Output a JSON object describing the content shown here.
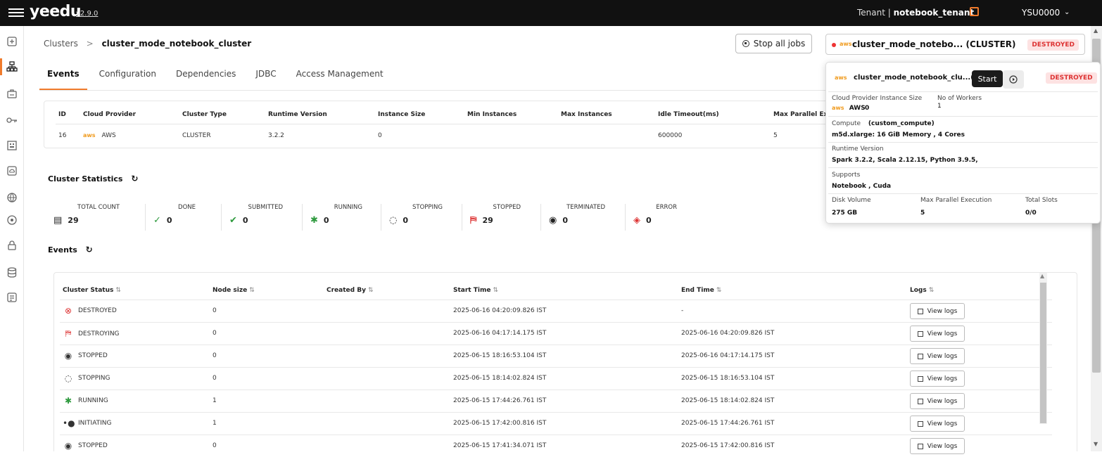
{
  "app": {
    "logo": "yeedu",
    "version": "v2.9.0",
    "tenant_label": "Tenant |",
    "tenant_name": "notebook_tenant",
    "user": "YSU0000",
    "accent_color": "#f07b2c"
  },
  "sidebar": {
    "items": [
      {
        "icon": "add-square-icon"
      },
      {
        "icon": "cluster-icon",
        "active": true
      },
      {
        "icon": "workspace-icon"
      },
      {
        "icon": "key-icon"
      },
      {
        "icon": "building-icon"
      },
      {
        "icon": "cloud-icon"
      },
      {
        "icon": "globe-icon"
      },
      {
        "icon": "target-icon"
      },
      {
        "icon": "lock-icon"
      },
      {
        "icon": "database-icon"
      },
      {
        "icon": "notes-icon"
      }
    ]
  },
  "breadcrumb": {
    "parent": "Clusters",
    "separator": ">",
    "current": "cluster_mode_notebook_cluster"
  },
  "actions": {
    "stop_all_jobs": "Stop all jobs"
  },
  "cluster_selector": {
    "provider": "aws",
    "name": "cluster_mode_notebo... (CLUSTER)",
    "status": "DESTROYED"
  },
  "tabs": [
    "Events",
    "Configuration",
    "Dependencies",
    "JDBC",
    "Access Management"
  ],
  "info_table": {
    "headers": [
      "ID",
      "Cloud Provider",
      "Cluster Type",
      "Runtime Version",
      "Instance Size",
      "Min Instances",
      "Max Instances",
      "Idle Timeout(ms)",
      "Max Parallel Ex"
    ],
    "values": {
      "id": "16",
      "provider_icon": "aws",
      "provider": "AWS",
      "cluster_type": "CLUSTER",
      "runtime_version": "3.2.2",
      "instance_size": "0",
      "min_instances": "",
      "max_instances": "",
      "idle_timeout": "600000",
      "max_parallel": "5"
    }
  },
  "cluster_statistics": {
    "title": "Cluster Statistics",
    "stats": [
      {
        "label": "TOTAL COUNT",
        "value": "29",
        "icon": "list-icon"
      },
      {
        "label": "DONE",
        "value": "0",
        "icon": "check-circle-icon"
      },
      {
        "label": "SUBMITTED",
        "value": "0",
        "icon": "double-check-icon"
      },
      {
        "label": "RUNNING",
        "value": "0",
        "icon": "running-icon"
      },
      {
        "label": "STOPPING",
        "value": "0",
        "icon": "stopping-icon"
      },
      {
        "label": "STOPPED",
        "value": "29",
        "icon": "stopped-icon"
      },
      {
        "label": "TERMINATED",
        "value": "0",
        "icon": "terminated-icon"
      },
      {
        "label": "ERROR",
        "value": "0",
        "icon": "error-icon"
      }
    ]
  },
  "events": {
    "title": "Events",
    "headers": [
      "Cluster Status",
      "Node size",
      "Created By",
      "Start Time",
      "End Time",
      "Logs"
    ],
    "sort_glyph": "⇅",
    "logs_label": "View logs",
    "rows": [
      {
        "status": "DESTROYED",
        "icon": "destroyed-icon",
        "node_size": "0",
        "created_by": "",
        "start": "2025-06-16 04:20:09.826 IST",
        "end": "-"
      },
      {
        "status": "DESTROYING",
        "icon": "destroying-icon",
        "node_size": "0",
        "created_by": "",
        "start": "2025-06-16 04:17:14.175 IST",
        "end": "2025-06-16 04:20:09.826 IST"
      },
      {
        "status": "STOPPED",
        "icon": "stopped-icon",
        "node_size": "0",
        "created_by": "",
        "start": "2025-06-15 18:16:53.104 IST",
        "end": "2025-06-16 04:17:14.175 IST"
      },
      {
        "status": "STOPPING",
        "icon": "stopping-icon",
        "node_size": "0",
        "created_by": "",
        "start": "2025-06-15 18:14:02.824 IST",
        "end": "2025-06-15 18:16:53.104 IST"
      },
      {
        "status": "RUNNING",
        "icon": "running-icon",
        "node_size": "1",
        "created_by": "",
        "start": "2025-06-15 17:44:26.761 IST",
        "end": "2025-06-15 18:14:02.824 IST"
      },
      {
        "status": "INITIATING",
        "icon": "initiating-icon",
        "node_size": "1",
        "created_by": "",
        "start": "2025-06-15 17:42:00.816 IST",
        "end": "2025-06-15 17:44:26.761 IST"
      },
      {
        "status": "STOPPED",
        "icon": "stopped-icon",
        "node_size": "0",
        "created_by": "",
        "start": "2025-06-15 17:41:34.071 IST",
        "end": "2025-06-15 17:42:00.816 IST"
      }
    ]
  },
  "popup": {
    "provider": "aws",
    "name": "cluster_mode_notebook_clu...(C",
    "tooltip": "Start",
    "status": "DESTROYED",
    "instance_size_label": "Cloud Provider Instance Size",
    "workers_label": "No of Workers",
    "provider_value": "AWS",
    "instance_size_value": "0",
    "workers_value": "1",
    "compute_label": "Compute",
    "compute_name": "(custom_compute)",
    "compute_value": "m5d.xlarge: 16 GiB Memory , 4 Cores",
    "runtime_label": "Runtime Version",
    "runtime_value": "Spark 3.2.2, Scala 2.12.15, Python 3.9.5,",
    "supports_label": "Supports",
    "supports_value": "Notebook , Cuda",
    "disk_label": "Disk Volume",
    "disk_value": "275 GB",
    "parallel_label": "Max Parallel Execution",
    "parallel_value": "5",
    "slots_label": "Total Slots",
    "slots_value": "0/0"
  }
}
